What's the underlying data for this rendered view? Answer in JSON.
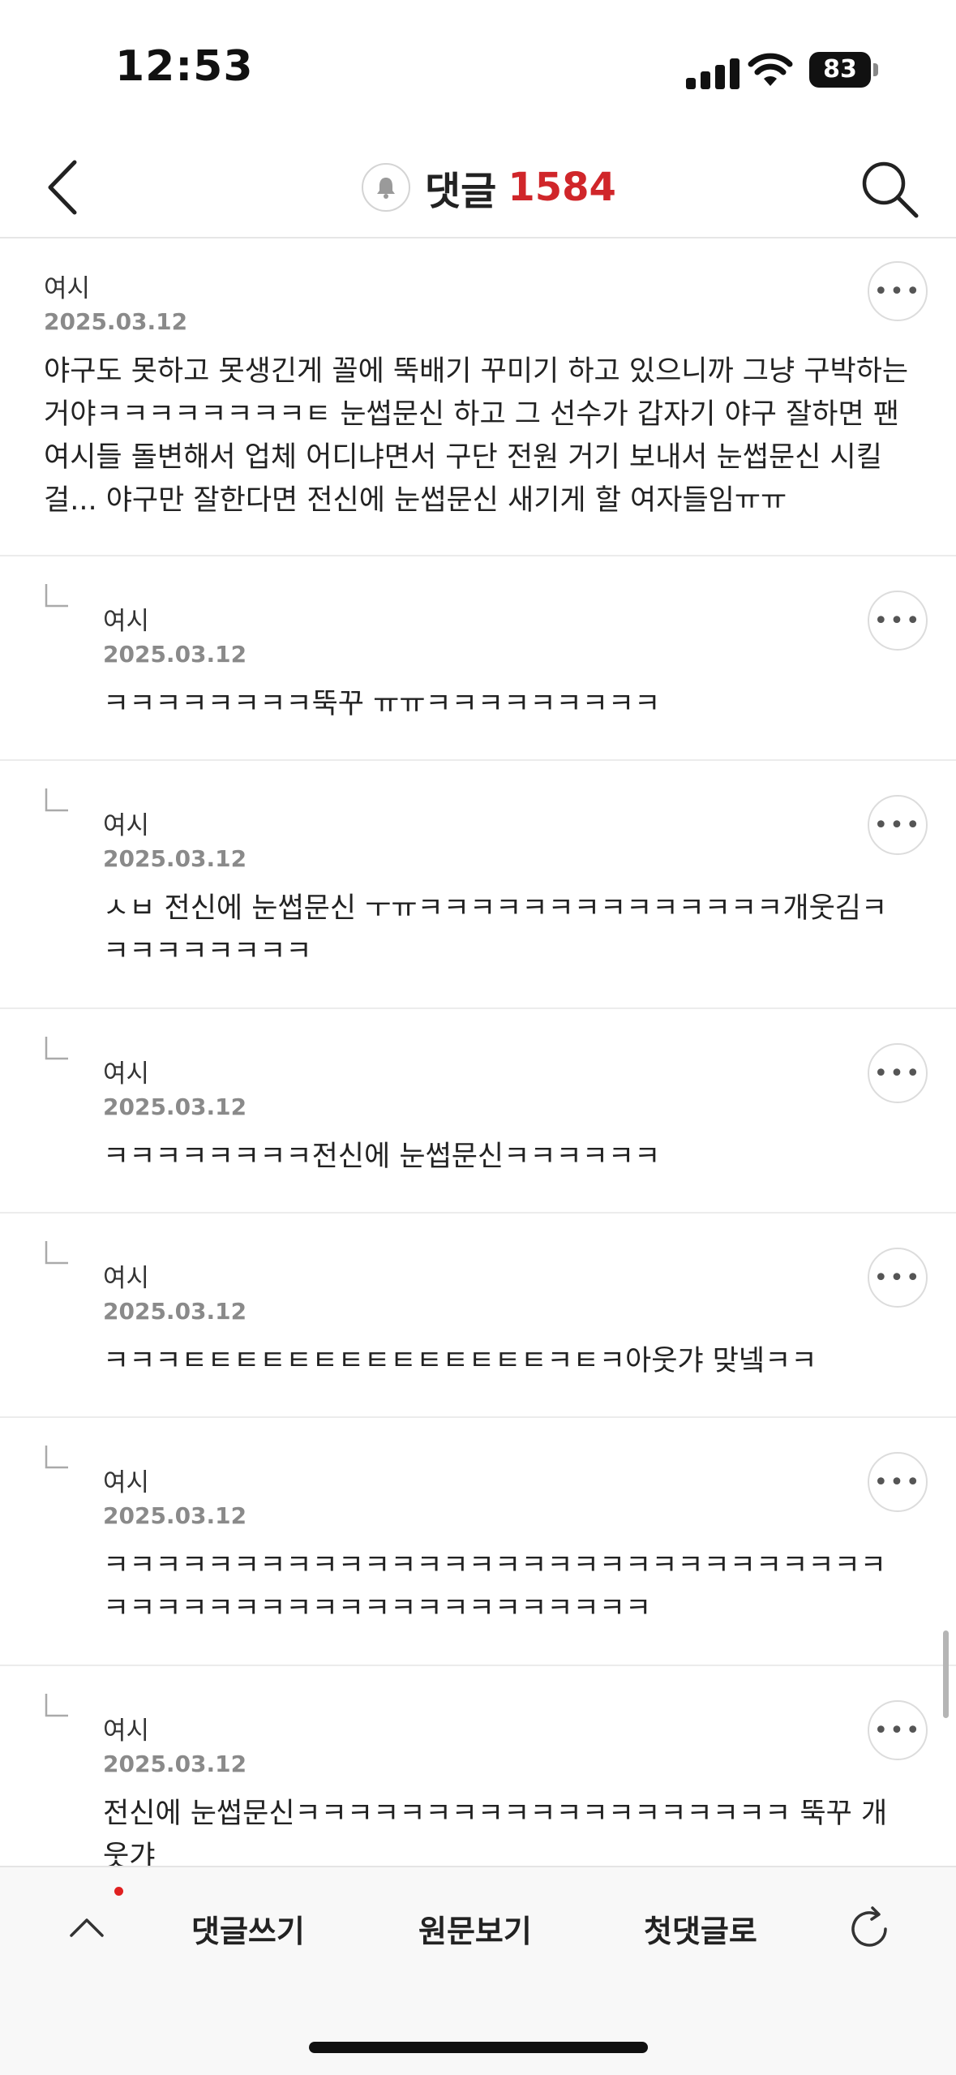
{
  "status": {
    "time": "12:53",
    "battery": "83"
  },
  "nav": {
    "title": "댓글",
    "count": "1584"
  },
  "comments": [
    {
      "author": "여시",
      "date": "2025.03.12",
      "text": "야구도 못하고 못생긴게 꼴에 뚝배기 꾸미기 하고 있으니까 그냥 구박하는 거야ㅋㅋㅋㅋㅋㅋㅋㅋㅌ 눈썹문신 하고 그 선수가 갑자기 야구 잘하면 팬여시들 돌변해서 업체 어디냐면서 구단 전원 거기 보내서 눈썹문신 시킬걸... 야구만 잘한다면 전신에 눈썹문신 새기게 할 여자들임ㅠㅠ"
    },
    {
      "author": "여시",
      "date": "2025.03.12",
      "text": "ㅋㅋㅋㅋㅋㅋㅋㅋ뚝꾸 ㅠㅠㅋㅋㅋㅋㅋㅋㅋㅋㅋ"
    },
    {
      "author": "여시",
      "date": "2025.03.12",
      "text": "ㅅㅂ 전신에 눈썹문신 ㅜㅠㅋㅋㅋㅋㅋㅋㅋㅋㅋㅋㅋㅋㅋㅋ개웃김ㅋㅋㅋㅋㅋㅋㅋㅋㅋ"
    },
    {
      "author": "여시",
      "date": "2025.03.12",
      "text": "ㅋㅋㅋㅋㅋㅋㅋㅋ전신에 눈썹문신ㅋㅋㅋㅋㅋㅋ"
    },
    {
      "author": "여시",
      "date": "2025.03.12",
      "text": "ㅋㅋㅋㅌㅌㅌㅌㅌㅌㅌㅌㅌㅌㅌㅌㅌㅌㅋㅌㅋ아웃갸 맞넼ㅋㅋ"
    },
    {
      "author": "여시",
      "date": "2025.03.12",
      "text": "ㅋㅋㅋㅋㅋㅋㅋㅋㅋㅋㅋㅋㅋㅋㅋㅋㅋㅋㅋㅋㅋㅋㅋㅋㅋㅋㅋㅋㅋㅋㅋㅋㅋㅋㅋㅋㅋㅋㅋㅋㅋㅋㅋㅋㅋㅋㅋㅋㅋㅋㅋ"
    },
    {
      "author": "여시",
      "date": "2025.03.12",
      "text": "전신에 눈썹문신ㅋㅋㅋㅋㅋㅋㅋㅋㅋㅋㅋㅋㅋㅋㅋㅋㅋㅋㅋ 뚝꾸 개웃갸"
    }
  ],
  "bottom": {
    "write": "댓글쓰기",
    "original": "원문보기",
    "first": "첫댓글로"
  }
}
